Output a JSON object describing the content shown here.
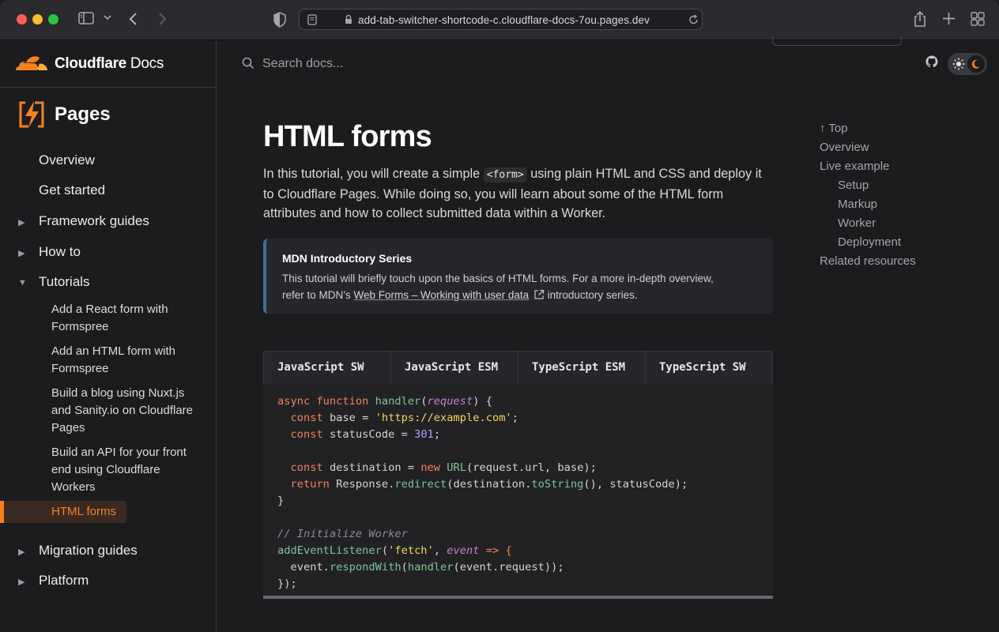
{
  "browser": {
    "url": "add-tab-switcher-shortcode-c.cloudflare-docs-7ou.pages.dev"
  },
  "site": {
    "brand_bold": "Cloudflare",
    "brand_rest": " Docs",
    "product": "Pages"
  },
  "search": {
    "placeholder": "Search docs..."
  },
  "sidebar": {
    "items": [
      {
        "label": "Overview"
      },
      {
        "label": "Get started"
      },
      {
        "label": "Framework guides"
      },
      {
        "label": "How to"
      },
      {
        "label": "Tutorials"
      },
      {
        "label": "Migration guides"
      },
      {
        "label": "Platform"
      }
    ],
    "tutorials": [
      {
        "lines": [
          "Add a React form with",
          "Formspree"
        ]
      },
      {
        "lines": [
          "Add an HTML form with",
          "Formspree"
        ]
      },
      {
        "lines": [
          "Build a blog using Nuxt.js",
          "and Sanity.io on Cloudflare",
          "Pages"
        ]
      },
      {
        "lines": [
          "Build an API for your front",
          "end using Cloudflare",
          "Workers"
        ]
      },
      {
        "lines": [
          "HTML forms"
        ]
      }
    ]
  },
  "main": {
    "title": "HTML forms",
    "intro_before": "In this tutorial, you will create a simple ",
    "intro_code": "<form>",
    "intro_line1_after": " using plain HTML and CSS and deploy it",
    "intro_line2": "to Cloudflare Pages. While doing so, you will learn about some of the HTML form",
    "intro_line3": "attributes and how to collect submitted data within a Worker.",
    "callout": {
      "title": "MDN Introductory Series",
      "line1": "This tutorial will briefly touch upon the basics of HTML forms. For a more in-depth overview,",
      "line2_before": "refer to MDN’s ",
      "link": "Web Forms – Working with user data",
      "line2_after": " introductory series."
    },
    "tabs": [
      "JavaScript SW",
      "JavaScript ESM",
      "TypeScript ESM",
      "TypeScript SW"
    ],
    "code": {
      "l1_a": "async function ",
      "l1_b": "handler",
      "l1_c": "(",
      "l1_d": "request",
      "l1_e": ") {",
      "l2_a": "  const ",
      "l2_b": "base = ",
      "l2_c": "'https://example.com'",
      "l2_d": ";",
      "l3_a": "  const ",
      "l3_b": "statusCode = ",
      "l3_c": "301",
      "l3_d": ";",
      "l5_a": "  const ",
      "l5_b": "destination = ",
      "l5_c": "new ",
      "l5_d": "URL",
      "l5_e": "(request.url, base);",
      "l6_a": "  return ",
      "l6_b": "Response.",
      "l6_c": "redirect",
      "l6_d": "(destination.",
      "l6_e": "toString",
      "l6_f": "(), statusCode);",
      "l7": "}",
      "l9": "// Initialize Worker",
      "l10_a": "addEventListener",
      "l10_b": "(",
      "l10_c": "'fetch'",
      "l10_d": ", ",
      "l10_e": "event",
      "l10_f": " => {",
      "l11_a": "  event.",
      "l11_b": "respondWith",
      "l11_c": "(",
      "l11_d": "handler",
      "l11_e": "(event.request));",
      "l12": "});"
    }
  },
  "toc": {
    "items": [
      "↑ Top",
      "Overview",
      "Live example",
      "Setup",
      "Markup",
      "Worker",
      "Deployment",
      "Related resources"
    ]
  },
  "colors": {
    "accent": "#f6821f",
    "callout_border": "#3b6f9d",
    "background": "#1c1c1e"
  }
}
